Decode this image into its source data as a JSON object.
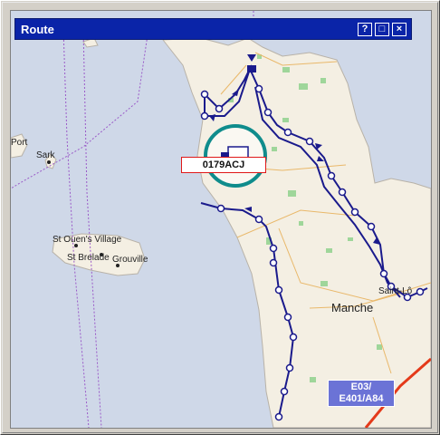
{
  "window": {
    "title": "Route",
    "buttons": {
      "help": "?",
      "maximize": "□",
      "close": "×"
    }
  },
  "map": {
    "places": [
      {
        "key": "port",
        "label": "Port"
      },
      {
        "key": "sark",
        "label": "Sark"
      },
      {
        "key": "st_ouens_village",
        "label": "St Ouen's Village"
      },
      {
        "key": "st_brelade",
        "label": "St Brelade"
      },
      {
        "key": "grouville",
        "label": "Grouville"
      },
      {
        "key": "manche",
        "label": "Manche"
      },
      {
        "key": "saint_lo",
        "label": "Saint-Lô"
      }
    ],
    "vehicle_label": "0179ACJ",
    "road_shield": {
      "line1": "E03/",
      "line2": "E401/A84"
    },
    "colors": {
      "sea": "#cfd8e8",
      "land": "#f4efe3",
      "route": "#1a1a8c",
      "vehicle_ring": "#0f8c8c",
      "highway": "#e43a1a"
    }
  }
}
